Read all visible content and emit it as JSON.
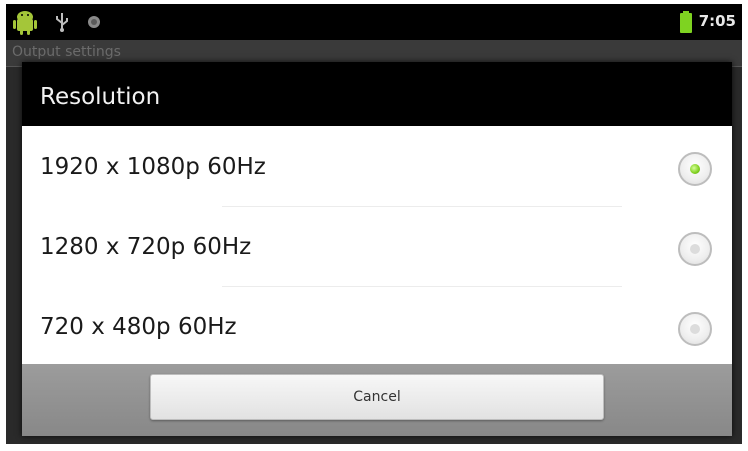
{
  "status_bar": {
    "time": "7:05",
    "icons": [
      "android-icon",
      "usb-icon",
      "debug-icon",
      "battery-icon"
    ],
    "battery_color": "#7ed321"
  },
  "background": {
    "title": "Output settings"
  },
  "dialog": {
    "title": "Resolution",
    "options": [
      {
        "label": "1920 x 1080p 60Hz",
        "selected": true
      },
      {
        "label": "1280 x 720p 60Hz",
        "selected": false
      },
      {
        "label": "720 x 480p 60Hz",
        "selected": false
      }
    ],
    "cancel_label": "Cancel",
    "accent_color": "#7fcf1e"
  }
}
